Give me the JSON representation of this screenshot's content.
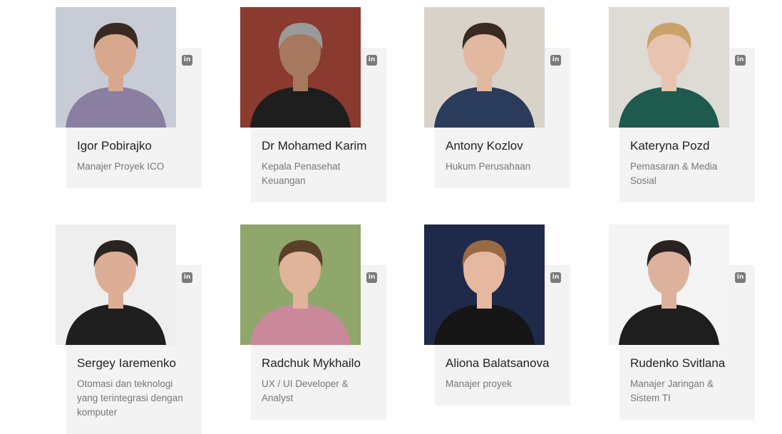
{
  "team": [
    {
      "name": "Igor Pobirajko",
      "role": "Manajer Proyek ICO",
      "icon": "linkedin-icon",
      "icon_glyph": "in"
    },
    {
      "name": "Dr Mohamed Karim",
      "role": "Kepala Penasehat Keuangan",
      "icon": "linkedin-icon",
      "icon_glyph": "in"
    },
    {
      "name": "Antony Kozlov",
      "role": "Hukum Perusahaan",
      "icon": "linkedin-icon",
      "icon_glyph": "in"
    },
    {
      "name": "Kateryna Pozd",
      "role": "Pemasaran & Media Sosial",
      "icon": "linkedin-icon",
      "icon_glyph": "in"
    },
    {
      "name": "Sergey Iaremenko",
      "role": "Otomasi dan teknologi yang terintegrasi dengan komputer",
      "icon": "linkedin-icon",
      "icon_glyph": "in"
    },
    {
      "name": "Radchuk Mykhailo",
      "role": "UX / UI Developer & Analyst",
      "icon": "linkedin-icon",
      "icon_glyph": "in"
    },
    {
      "name": "Aliona Balatsanova",
      "role": "Manajer proyek",
      "icon": "linkedin-icon",
      "icon_glyph": "in"
    },
    {
      "name": "Rudenko Svitlana",
      "role": "Manajer Jaringan & Sistem TI",
      "icon": "linkedin-icon",
      "icon_glyph": "in"
    }
  ],
  "photo_colors": [
    {
      "bg": "#c8ccd6",
      "skin": "#d8a88e",
      "hair": "#3a2a22",
      "shirt": "#8a7fa0"
    },
    {
      "bg": "#8a3a2e",
      "skin": "#a6785e",
      "hair": "#9a9a9a",
      "shirt": "#1e1e1e"
    },
    {
      "bg": "#d9d2c8",
      "skin": "#e2b8a0",
      "hair": "#3a2b22",
      "shirt": "#2b3b5c"
    },
    {
      "bg": "#dedad4",
      "skin": "#e8c4b0",
      "hair": "#c9a26a",
      "shirt": "#1f5a4e"
    },
    {
      "bg": "#eeeeee",
      "skin": "#dcae96",
      "hair": "#2a2420",
      "shirt": "#1f1f1f"
    },
    {
      "bg": "#8fa76a",
      "skin": "#e0b49a",
      "hair": "#5a3f2a",
      "shirt": "#c9899a"
    },
    {
      "bg": "#1f2a4a",
      "skin": "#e6b8a0",
      "hair": "#9a6a44",
      "shirt": "#161616"
    },
    {
      "bg": "#f4f4f4",
      "skin": "#dcb29c",
      "hair": "#2a2220",
      "shirt": "#1e1e1e"
    }
  ]
}
